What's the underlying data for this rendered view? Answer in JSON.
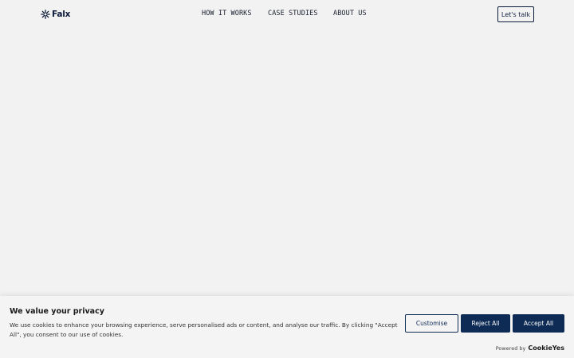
{
  "header": {
    "logo_text": "Falx",
    "nav": {
      "how_it_works": "HOW IT WORKS",
      "case_studies": "CASE STUDIES",
      "about_us": "ABOUT US"
    },
    "cta_label": "Let's talk"
  },
  "cookie_banner": {
    "title": "We value your privacy",
    "text": "We use cookies to enhance your browsing experience, serve personalised ads or content, and analyse our traffic. By clicking \"Accept All\", you consent to our use of cookies.",
    "buttons": {
      "customise": "Customise",
      "reject_all": "Reject All",
      "accept_all": "Accept All"
    },
    "powered_by_label": "Powered by",
    "powered_by_brand": "CookieYes"
  },
  "colors": {
    "background": "#f2f2f2",
    "brand_navy": "#0d1b3a",
    "button_navy": "#0d2b55"
  }
}
